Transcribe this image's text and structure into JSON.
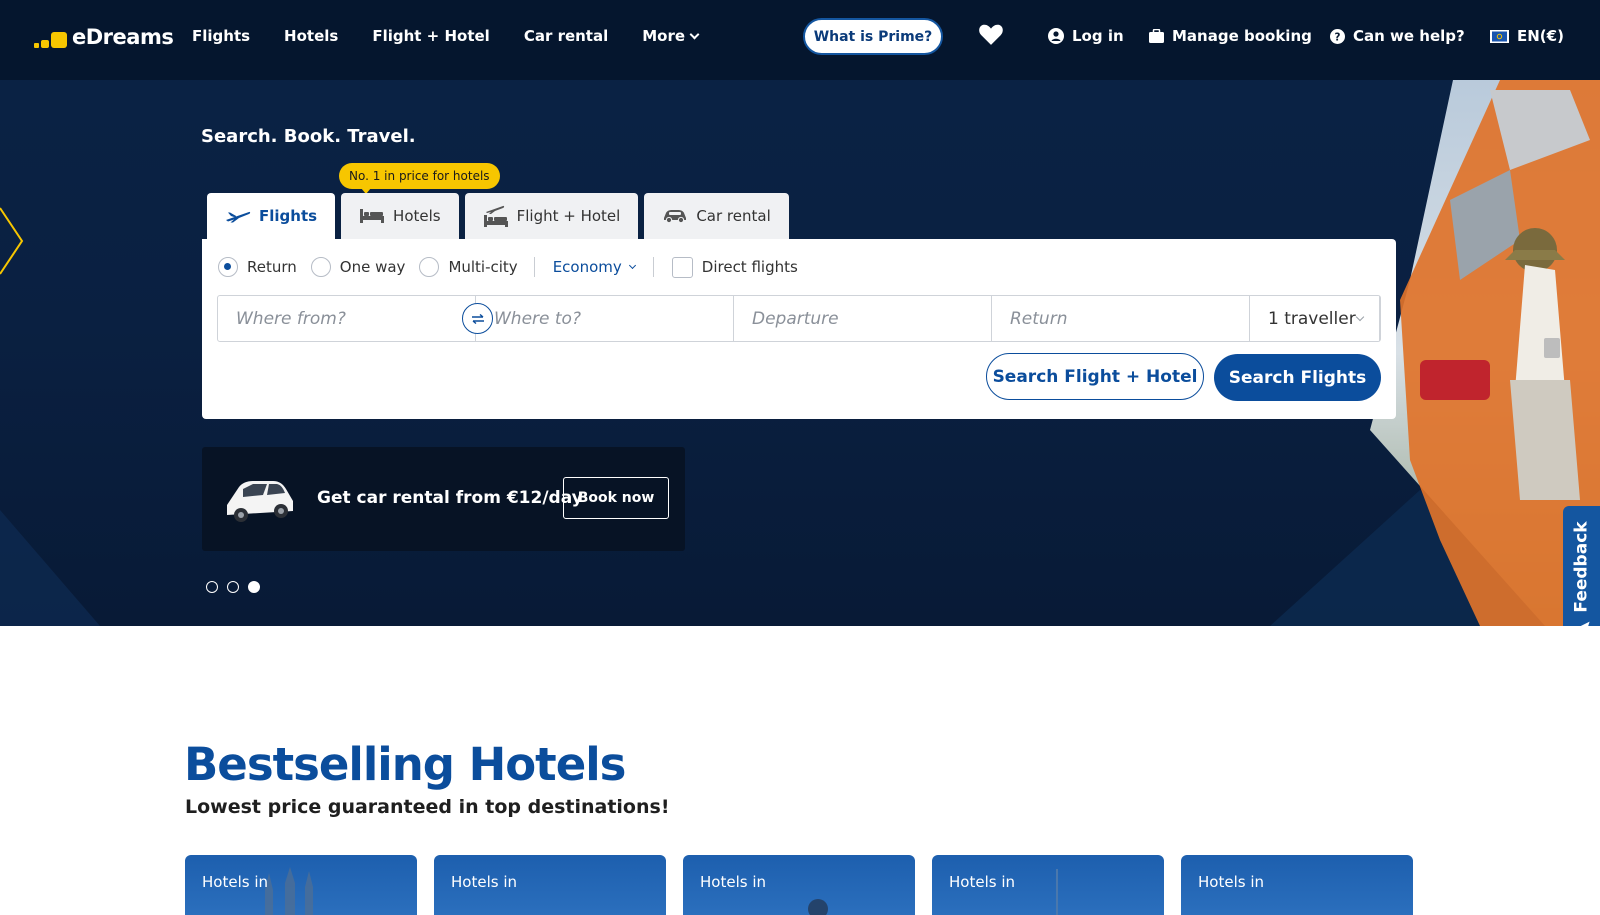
{
  "brand": {
    "name": "eDreams",
    "accent": "#f7c600",
    "primary": "#0b4d9c",
    "nav_bg": "#05162e"
  },
  "nav": {
    "links": [
      "Flights",
      "Hotels",
      "Flight + Hotel",
      "Car rental"
    ],
    "more_label": "More",
    "prime_label": "What is Prime?",
    "login_label": "Log in",
    "manage_label": "Manage booking",
    "help_label": "Can we help?",
    "lang_label": "EN(€)"
  },
  "hero": {
    "tagline": "Search. Book. Travel.",
    "badge": "No. 1 in price for hotels",
    "tabs": [
      {
        "label": "Flights",
        "icon": "plane-icon",
        "active": true
      },
      {
        "label": "Hotels",
        "icon": "bed-icon",
        "active": false
      },
      {
        "label": "Flight + Hotel",
        "icon": "plane-bed-icon",
        "active": false
      },
      {
        "label": "Car rental",
        "icon": "car-icon",
        "active": false
      }
    ],
    "trip_types": [
      {
        "label": "Return",
        "checked": true
      },
      {
        "label": "One way",
        "checked": false
      },
      {
        "label": "Multi-city",
        "checked": false
      }
    ],
    "cabin_class": "Economy",
    "direct_flights_label": "Direct flights",
    "direct_flights_checked": false,
    "fields": {
      "from_placeholder": "Where from?",
      "to_placeholder": "Where to?",
      "departure_placeholder": "Departure",
      "return_placeholder": "Return",
      "travellers": "1 traveller"
    },
    "search_combo_label": "Search Flight + Hotel",
    "search_label": "Search Flights",
    "promo": {
      "text": "Get car rental from €12/day",
      "button": "Book now"
    },
    "carousel": {
      "count": 3,
      "active_index": 2
    }
  },
  "feedback_label": "Feedback",
  "bestselling": {
    "title": "Bestselling Hotels",
    "subtitle": "Lowest price guaranteed in top destinations!",
    "cards": [
      "Hotels in",
      "Hotels in",
      "Hotels in",
      "Hotels in",
      "Hotels in"
    ]
  }
}
